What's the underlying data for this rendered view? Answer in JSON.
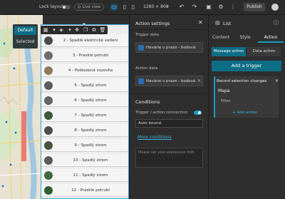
{
  "topbar": {
    "lock_layout": "Lock layout",
    "live_view": "Live view",
    "resolution": "1280 × 800",
    "publish": "Publish"
  },
  "colors": {
    "accent": "#1a9cbf",
    "accent_dark": "#0d6d85",
    "selection": "#3aa5d8"
  },
  "map_popup": {
    "default": "Default",
    "selected": "Selected"
  },
  "list": {
    "rows": [
      {
        "label": "2 - Spadlé elektrické vedení",
        "thumb": "#4b4b4b"
      },
      {
        "label": "3 - Prasklé potrubí",
        "thumb": "#6e6e6e"
      },
      {
        "label": "4 - Poškozená vozovka",
        "thumb": "#8a7b5a"
      },
      {
        "label": "5 - Spadlý strom",
        "thumb": "#5d5d5d"
      },
      {
        "label": "6 - Spadlý strom",
        "thumb": "#656565"
      },
      {
        "label": "7 - Spadlý strom",
        "thumb": "#3d5a3b"
      },
      {
        "label": "8 - Spadlý strom",
        "thumb": "#4d4d4d"
      },
      {
        "label": "9 - Spadlý strom",
        "thumb": "#44543f"
      },
      {
        "label": "10 - Spadlý strom",
        "thumb": "#5a5a5a"
      },
      {
        "label": "11 - Spadlý strom",
        "thumb": "#3f6a42"
      },
      {
        "label": "12 - Prasklé potrubí",
        "thumb": "#2f5e2f"
      }
    ]
  },
  "action_settings": {
    "title": "Action settings",
    "trigger_data_label": "Trigger data",
    "trigger_data_value": "Havárie v praze - bodová ...",
    "action_data_label": "Action data",
    "action_data_value": "Havárie v praze - bodová ...",
    "conditions_heading": "Conditions",
    "connection_label": "Trigger / action connection",
    "auto_bound": "Auto bound.",
    "more_conditions": "More conditions",
    "expression_placeholder": "Please set your expression first."
  },
  "right_panel": {
    "title": "List",
    "tabs": [
      "Content",
      "Style",
      "Action"
    ],
    "active_tab": "Action",
    "segments": [
      "Message action",
      "Data action"
    ],
    "add_trigger": "Add a trigger",
    "card_title": "Record selection changes",
    "card_target": "Mapa",
    "card_filter": "Filter",
    "add_action": "+ Add action"
  }
}
